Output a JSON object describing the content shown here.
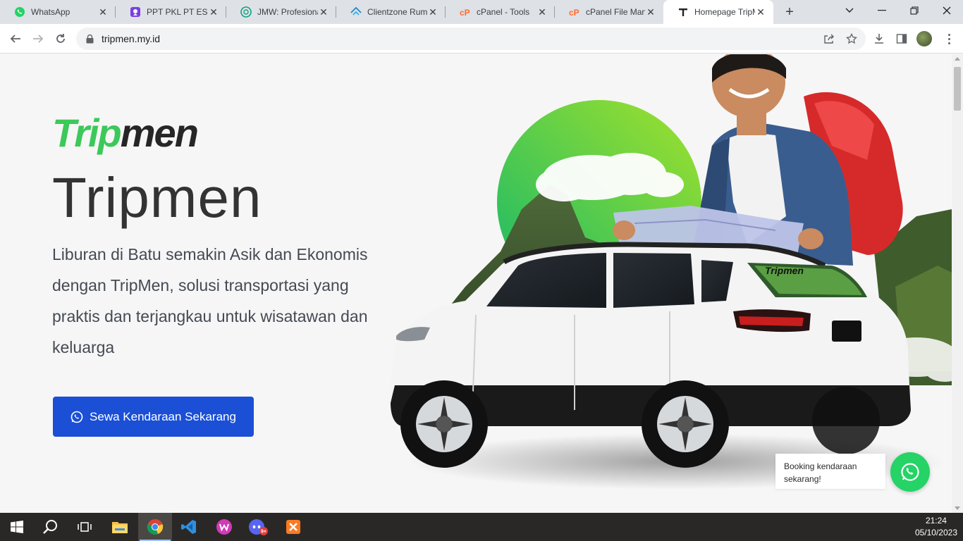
{
  "browser": {
    "tabs": [
      {
        "title": "WhatsApp",
        "icon": "whatsapp-icon",
        "active": false
      },
      {
        "title": "PPT PKL PT ESOC",
        "icon": "canva-icon",
        "active": false
      },
      {
        "title": "JMW: Profesiona",
        "icon": "chatgpt-icon",
        "active": false
      },
      {
        "title": "Clientzone Ruma",
        "icon": "rumahweb-icon",
        "active": false
      },
      {
        "title": "cPanel - Tools",
        "icon": "cpanel-icon",
        "active": false
      },
      {
        "title": "cPanel File Mana",
        "icon": "cpanel-icon",
        "active": false
      },
      {
        "title": "Homepage TripM",
        "icon": "tripmen-favicon",
        "active": true
      }
    ],
    "url": "tripmen.my.id"
  },
  "hero": {
    "logo_green": "Trip",
    "logo_dark": "men",
    "title": "Tripmen",
    "description": "Liburan di Batu semakin Asik dan Ekonomis dengan TripMen, solusi transportasi yang praktis dan terjangkau untuk wisatawan dan keluarga",
    "cta_label": "Sewa Kendaraan Sekarang",
    "car_sticker": "Tripmen"
  },
  "whatsapp_widget": {
    "bubble_text": "Booking kendaraan sekarang!"
  },
  "taskbar": {
    "apps": [
      "start",
      "search",
      "task-view",
      "file-explorer",
      "chrome",
      "vscode",
      "wps-office",
      "discord-canary",
      "xampp"
    ],
    "discord_badge": "9+",
    "time": "21:24",
    "date": "05/10/2023"
  },
  "colors": {
    "brand_green": "#3dc85a",
    "cta_blue": "#1a4fd6",
    "whatsapp_green": "#25d366"
  }
}
